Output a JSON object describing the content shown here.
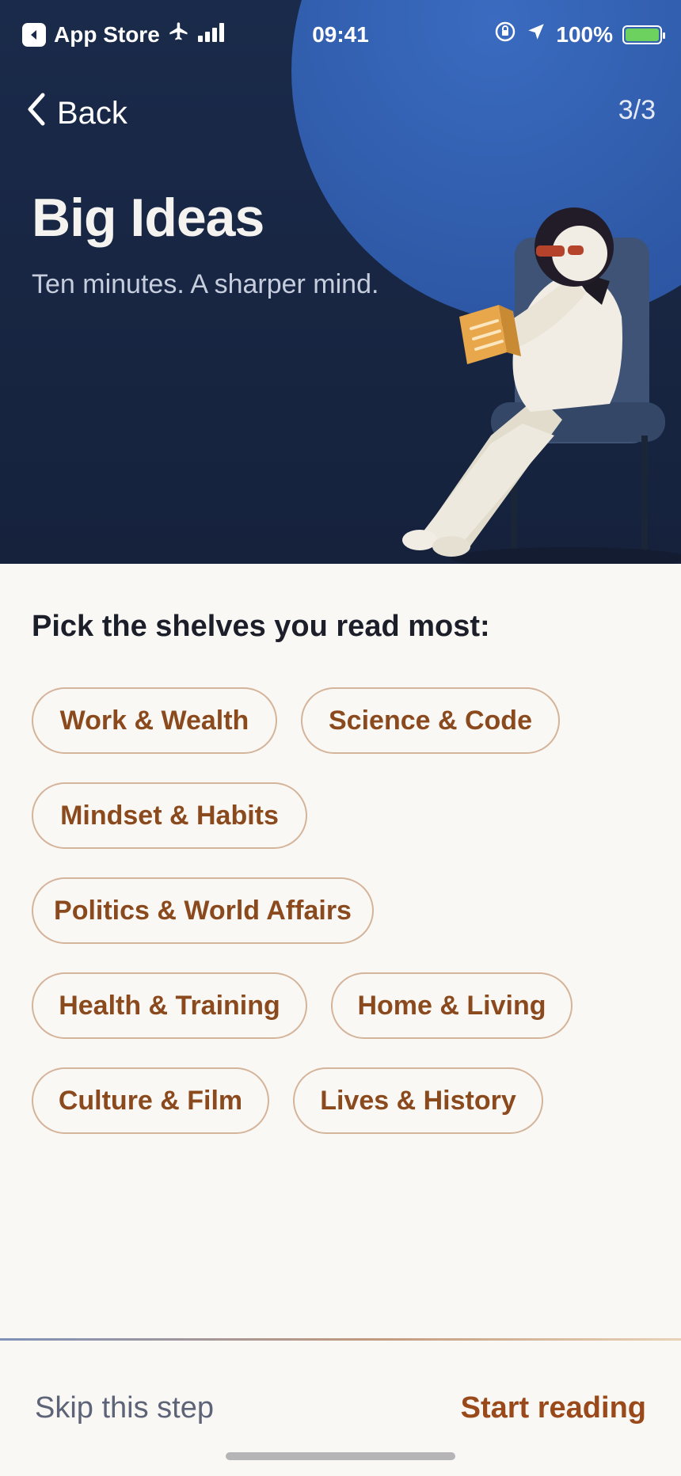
{
  "status_bar": {
    "app_name": "App Store",
    "time": "09:41",
    "battery": "100%",
    "icons": [
      "app-store-icon",
      "airplane-icon",
      "signal-icon",
      "lock-rotation-icon",
      "location-icon",
      "battery-icon"
    ]
  },
  "nav": {
    "back_label": "Back",
    "step": "3/3"
  },
  "hero": {
    "title": "Big Ideas",
    "tagline": "Ten minutes. A sharper mind."
  },
  "main": {
    "prompt": "Pick the shelves you read most:",
    "chips": [
      "Work & Wealth",
      "Science & Code",
      "Mindset & Habits",
      "Politics & World Affairs",
      "Health & Training",
      "Home & Living",
      "Culture & Film",
      "Lives & History"
    ]
  },
  "footer": {
    "skip_label": "Skip this step",
    "start_label": "Start reading"
  },
  "colors": {
    "accent": "#8B4A1E",
    "hero_bg": "#1A2A4A",
    "moon": "#2F5AA8",
    "page_bg": "#FAF8F4"
  }
}
